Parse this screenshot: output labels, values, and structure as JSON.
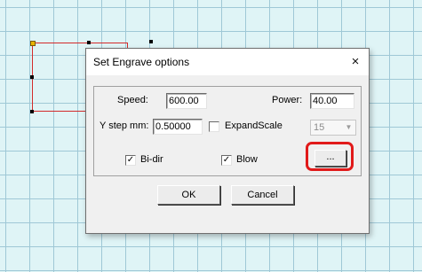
{
  "dialog": {
    "title": "Set Engrave options",
    "close_glyph": "×",
    "speed_label": "Speed:",
    "speed_value": "600.00",
    "power_label": "Power:",
    "power_value": "40.00",
    "ystep_label": "Y step mm:",
    "ystep_value": "0.50000",
    "expandscale_label": "ExpandScale",
    "expandscale_checked": false,
    "expandscale_value": "15",
    "bidir_label": "Bi-dir",
    "bidir_checked": true,
    "blow_label": "Blow",
    "blow_checked": true,
    "more_button_label": "...",
    "ok_label": "OK",
    "cancel_label": "Cancel",
    "check_mark": "✓"
  },
  "colors": {
    "highlight": "#e11a1a",
    "canvas_background": "#dff4f6",
    "grid": "#9fc8d6",
    "shape_outline": "#d32a2a"
  }
}
